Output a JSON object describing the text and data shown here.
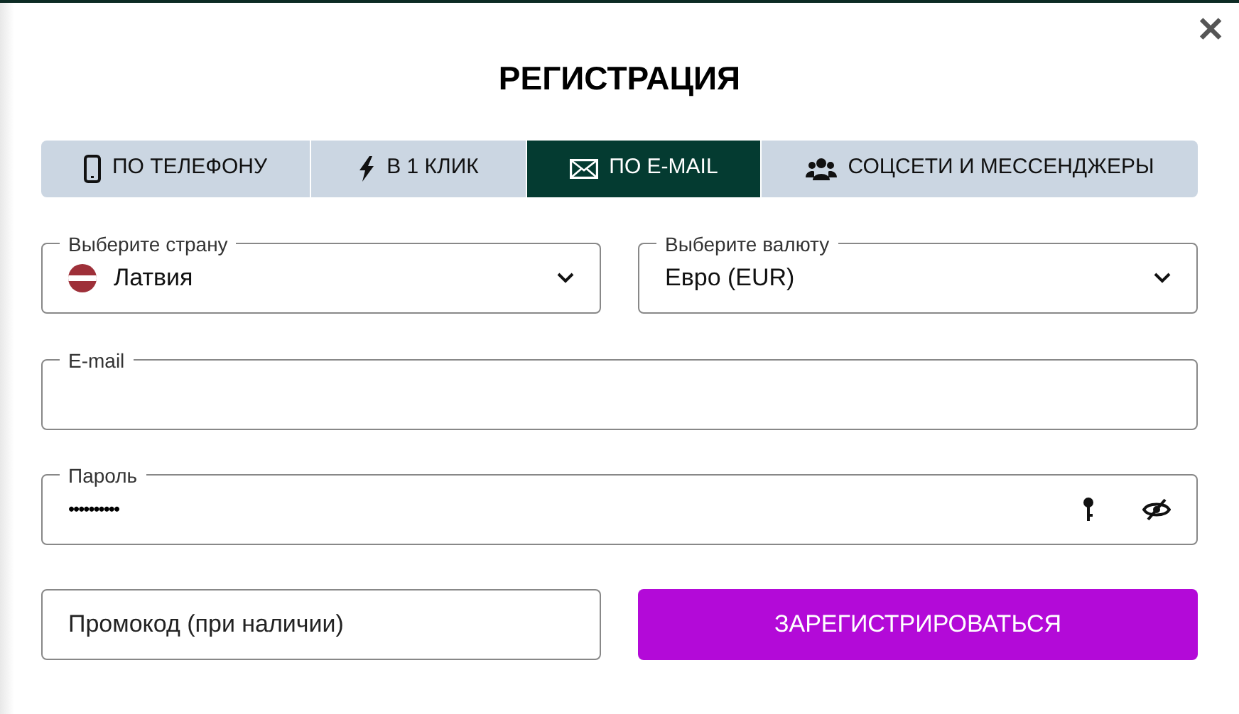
{
  "dialog": {
    "title": "РЕГИСТРАЦИЯ",
    "close": "✕"
  },
  "tabs": [
    {
      "label": "ПО ТЕЛЕФОНУ",
      "kind": "phone",
      "selected": false
    },
    {
      "label": "В 1 КЛИК",
      "kind": "bolt",
      "selected": false
    },
    {
      "label": "ПО E-MAIL",
      "kind": "mail",
      "selected": true
    },
    {
      "label": "СОЦСЕТИ И МЕССЕНДЖЕРЫ",
      "kind": "people",
      "selected": false
    }
  ],
  "country": {
    "label": "Выберите страну",
    "value": "Латвия"
  },
  "currency": {
    "label": "Выберите валюту",
    "value": "Евро (EUR)"
  },
  "email": {
    "label": "E-mail"
  },
  "password": {
    "label": "Пароль",
    "value": "••••••••••"
  },
  "promo": {
    "placeholder": "Промокод (при наличии)"
  },
  "submit": "ЗАРЕГИСТРИРОВАТЬСЯ"
}
